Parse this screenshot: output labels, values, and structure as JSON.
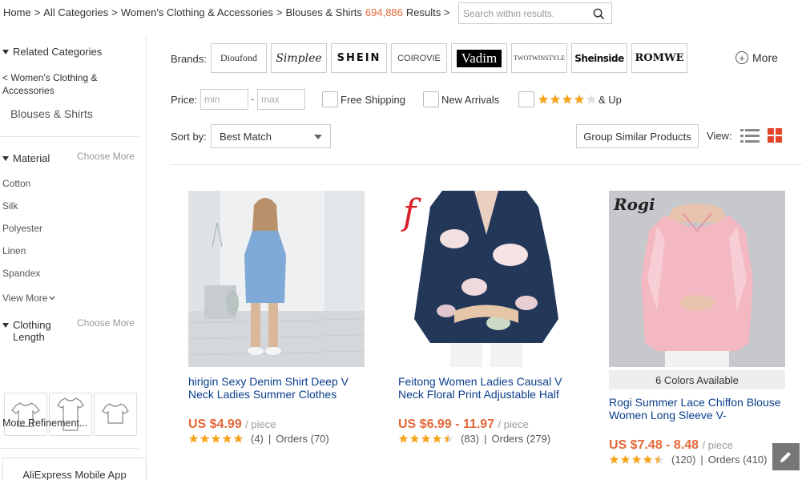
{
  "breadcrumb": {
    "items": [
      "Home",
      "All Categories",
      "Women's Clothing & Accessories",
      "Blouses & Shirts"
    ],
    "separator": ">",
    "result_count": "694,886",
    "results_label": "Results >"
  },
  "search": {
    "placeholder": "Search within results."
  },
  "sidebar": {
    "related_title": "Related Categories",
    "parent_link": "< Women's Clothing & Accessories",
    "current_category": "Blouses & Shirts",
    "material_title": "Material",
    "choose_more": "Choose More",
    "materials": [
      "Cotton",
      "Silk",
      "Polyester",
      "Linen",
      "Spandex"
    ],
    "view_more": "View More",
    "length_title": "Clothing Length",
    "more_refinement": "More Refinement...",
    "app_label": "AliExpress Mobile App"
  },
  "brands": {
    "label": "Brands:",
    "items": [
      "Dioufond",
      "Simplee",
      "SHEIN",
      "COIROVIE",
      "Vadim",
      "TWOTWINSTYLE",
      "Sheinside",
      "ROMWE"
    ],
    "more_label": "More"
  },
  "filters": {
    "price_label": "Price:",
    "min_placeholder": "min",
    "max_placeholder": "max",
    "dash": "-",
    "free_shipping": "Free Shipping",
    "new_arrivals": "New Arrivals",
    "rating_label": "& Up",
    "rating_stars": 4
  },
  "sort": {
    "label": "Sort by:",
    "selected": "Best Match",
    "group_button": "Group Similar Products",
    "view_label": "View:"
  },
  "products": [
    {
      "title": "hirigin Sexy Denim Shirt Deep V Neck Ladies Summer Clothes",
      "price": "US $4.99",
      "unit": "/ piece",
      "rating": 5,
      "reviews": "(4)",
      "orders": "Orders (70)",
      "separator": "|"
    },
    {
      "title": "Feitong Women Ladies Causal V Neck Floral Print Adjustable Half",
      "price": "US $6.99 - 11.97",
      "unit": "/ piece",
      "rating": 4.5,
      "reviews": "(83)",
      "orders": "Orders (279)",
      "separator": "|",
      "brand_logo": "f"
    },
    {
      "title": "Rogi Summer Lace Chiffon Blouse Women Long Sleeve V-",
      "price": "US $7.48 - 8.48",
      "unit": "/ piece",
      "rating": 4.5,
      "reviews": "(120)",
      "orders": "Orders (410)",
      "separator": "|",
      "colors_available": "6 Colors Available",
      "brand_logo": "Rogi"
    }
  ],
  "colors": {
    "accent": "#e4693a",
    "link": "#0b3e8c",
    "star": "#f7a41d",
    "grid_icon": "#e4442a"
  }
}
